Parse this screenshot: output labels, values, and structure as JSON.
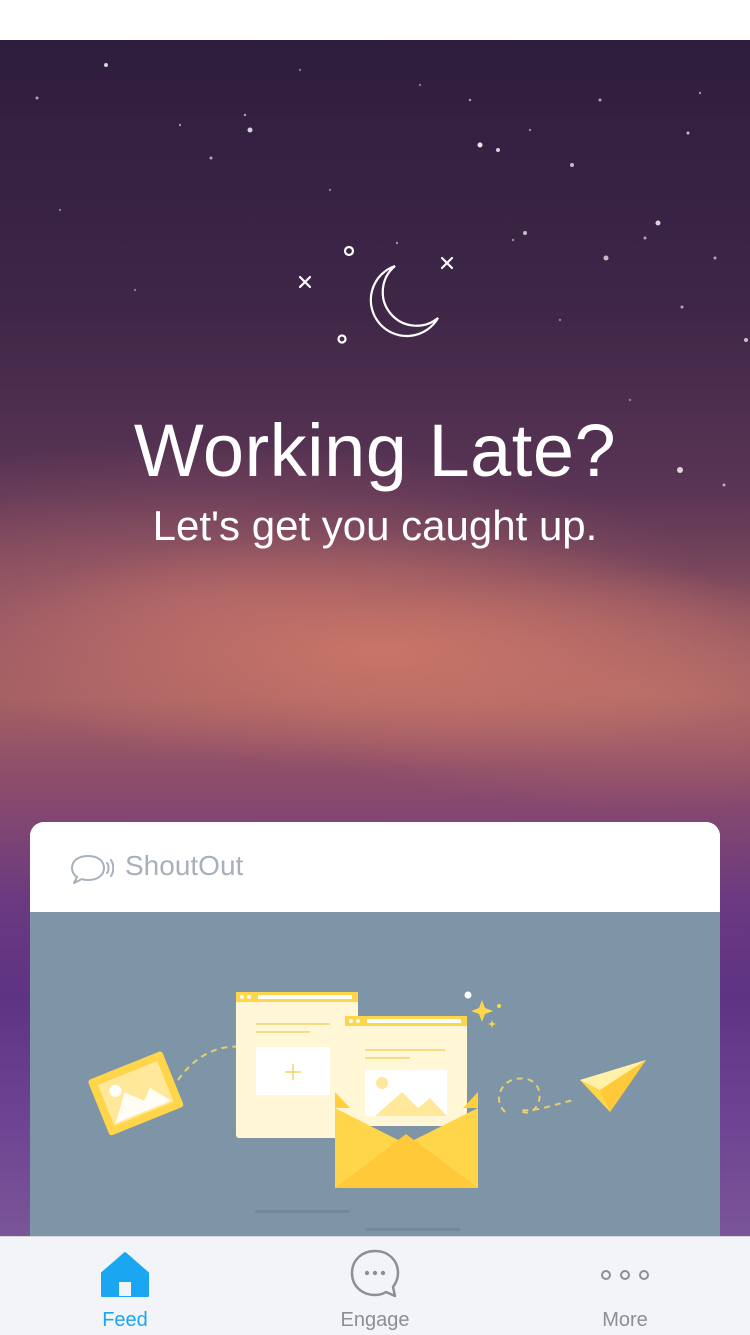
{
  "hero": {
    "title": "Working Late?",
    "subtitle": "Let's get you caught up."
  },
  "card": {
    "header_label": "ShoutOut"
  },
  "tab_bar": {
    "tabs": [
      {
        "label": "Feed",
        "icon": "home-icon",
        "active": true
      },
      {
        "label": "Engage",
        "icon": "chat-bubble-icon",
        "active": false
      },
      {
        "label": "More",
        "icon": "more-dots-icon",
        "active": false
      }
    ]
  },
  "colors": {
    "accent": "#1aa6f0",
    "tab_inactive": "#8e8e93",
    "card_body": "#7e95a7",
    "illustration_yellow": "#ffd54a"
  }
}
